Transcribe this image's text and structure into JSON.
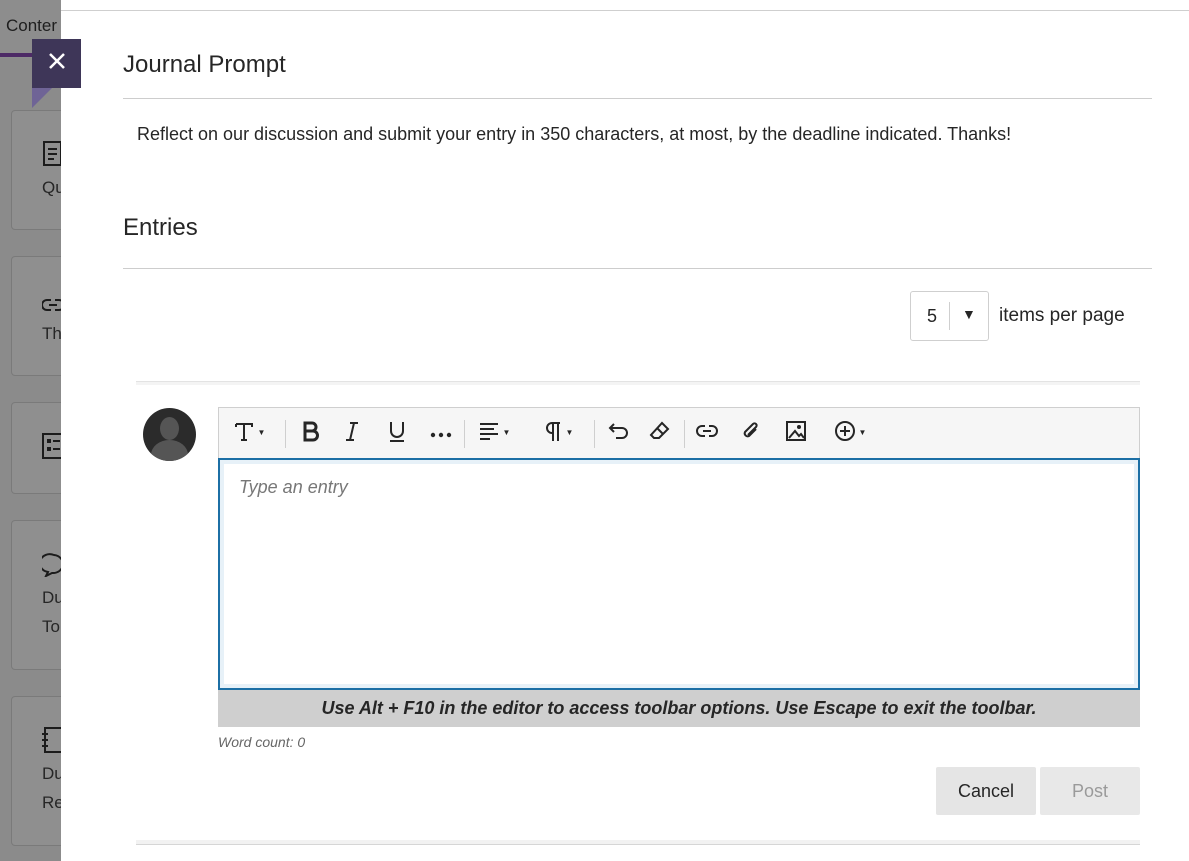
{
  "background": {
    "tab_label": "Conter",
    "cards": [
      {
        "icon": "document-icon",
        "text": "Qu"
      },
      {
        "icon": "link-icon",
        "text": "Th"
      },
      {
        "icon": "form-icon",
        "text": ""
      },
      {
        "icon": "discussion-icon",
        "text": "Du",
        "text2": "To"
      },
      {
        "icon": "journal-icon",
        "text": "Du",
        "text2": "Re"
      }
    ]
  },
  "panel": {
    "title": "Journal Prompt",
    "prompt_text": "Reflect on our discussion and submit your entry in 350 characters, at most, by the deadline indicated. Thanks!",
    "entries_heading": "Entries",
    "items_per_page": {
      "selected": "5",
      "label": "items per page"
    }
  },
  "editor": {
    "placeholder": "Type an entry",
    "toolbar": [
      "text-style-icon",
      "bold-icon",
      "italic-icon",
      "underline-icon",
      "more-icon",
      "align-icon",
      "paragraph-icon",
      "undo-icon",
      "clear-format-icon",
      "link-icon",
      "attachment-icon",
      "image-icon",
      "insert-content-icon"
    ],
    "hint": "Use Alt + F10 in the editor to access toolbar options. Use Escape to exit the toolbar.",
    "word_count": "Word count: 0"
  },
  "actions": {
    "cancel": "Cancel",
    "post": "Post"
  },
  "colors": {
    "close_button": "#3e3658",
    "editor_focus": "#1c6fa5",
    "tab_accent": "#4d2a66"
  }
}
